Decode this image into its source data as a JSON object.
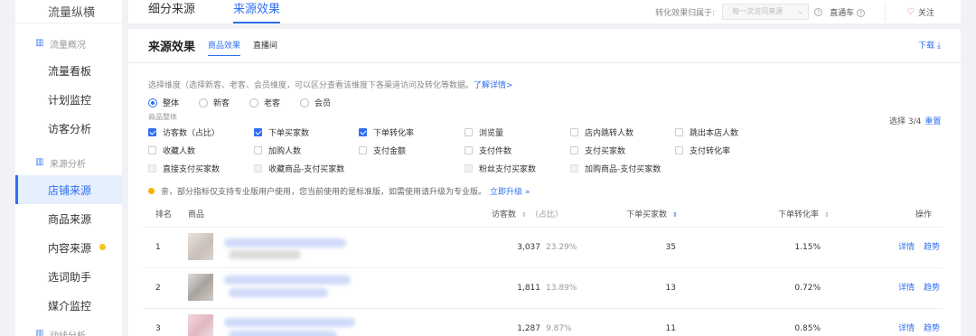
{
  "sidebar": {
    "top_label": "流量纵横",
    "groups": [
      {
        "label": "流量概况",
        "items": [
          "流量看板",
          "计划监控",
          "访客分析"
        ]
      },
      {
        "label": "来源分析",
        "items": [
          "店铺来源",
          "商品来源",
          "内容来源",
          "选词助手",
          "媒介监控"
        ]
      },
      {
        "label": "动线分析"
      }
    ],
    "active_item": "店铺来源"
  },
  "topbar": {
    "tabs": [
      "细分来源",
      "来源效果"
    ],
    "active_tab": "来源效果",
    "attribution_label": "转化效果归属于:",
    "attribution_value": "每一次访问来源",
    "ztc_label": "直通车",
    "follow_label": "关注"
  },
  "card": {
    "title": "来源效果",
    "sub_tabs": [
      "商品效果",
      "直播间"
    ],
    "active_sub_tab": "商品效果",
    "download_label": "下载"
  },
  "dimension": {
    "description": "选择维度（选择新客、老客、会员维度，可以区分查看该维度下各渠道访问及转化等数据。",
    "learn_more": "了解详情>",
    "options": [
      "整体",
      "新客",
      "老客",
      "会员"
    ],
    "selected": "整体"
  },
  "metrics": {
    "group_label": "商品整体",
    "selected_count": "选择 3/4",
    "reset_label": "重置",
    "items": [
      {
        "label": "访客数（占比）",
        "state": "on"
      },
      {
        "label": "下单买家数",
        "state": "on"
      },
      {
        "label": "下单转化率",
        "state": "on"
      },
      {
        "label": "浏览量",
        "state": "off"
      },
      {
        "label": "店内跳转人数",
        "state": "off"
      },
      {
        "label": "跳出本店人数",
        "state": "off"
      },
      {
        "label": "收藏人数",
        "state": "off"
      },
      {
        "label": "加购人数",
        "state": "off"
      },
      {
        "label": "支付金额",
        "state": "off"
      },
      {
        "label": "支付件数",
        "state": "off"
      },
      {
        "label": "支付买家数",
        "state": "off"
      },
      {
        "label": "支付转化率",
        "state": "off"
      },
      {
        "label": "直接支付买家数",
        "state": "disabled"
      },
      {
        "label": "收藏商品-支付买家数",
        "state": "disabled"
      },
      {
        "label": "粉丝支付买家数",
        "state": "disabled"
      },
      {
        "label": "加购商品-支付买家数",
        "state": "disabled"
      }
    ]
  },
  "notice": {
    "text": "亲，部分指标仅支持专业版用户使用，您当前使用的是标准版，如需使用请升级为专业版。",
    "link": "立即升级 »"
  },
  "table": {
    "headers": {
      "rank": "排名",
      "product": "商品",
      "visitors": "访客数",
      "share": "（占比）",
      "buyers": "下单买家数",
      "conversion": "下单转化率",
      "actions": "操作"
    },
    "rows": [
      {
        "rank": "1",
        "visitors": "3,037",
        "share": "23.29%",
        "buyers": "35",
        "conversion": "1.15%"
      },
      {
        "rank": "2",
        "visitors": "1,811",
        "share": "13.89%",
        "buyers": "13",
        "conversion": "0.72%"
      },
      {
        "rank": "3",
        "visitors": "1,287",
        "share": "9.87%",
        "buyers": "11",
        "conversion": "0.85%"
      }
    ],
    "action_labels": [
      "详情",
      "趋势"
    ]
  },
  "colors": {
    "accent": "#2f6ff0",
    "warning_dot": "#f5b301",
    "sidebar_active_bg": "#e6effe"
  },
  "icons": {
    "download": "download-icon",
    "heart": "heart-icon",
    "help": "question-icon"
  }
}
